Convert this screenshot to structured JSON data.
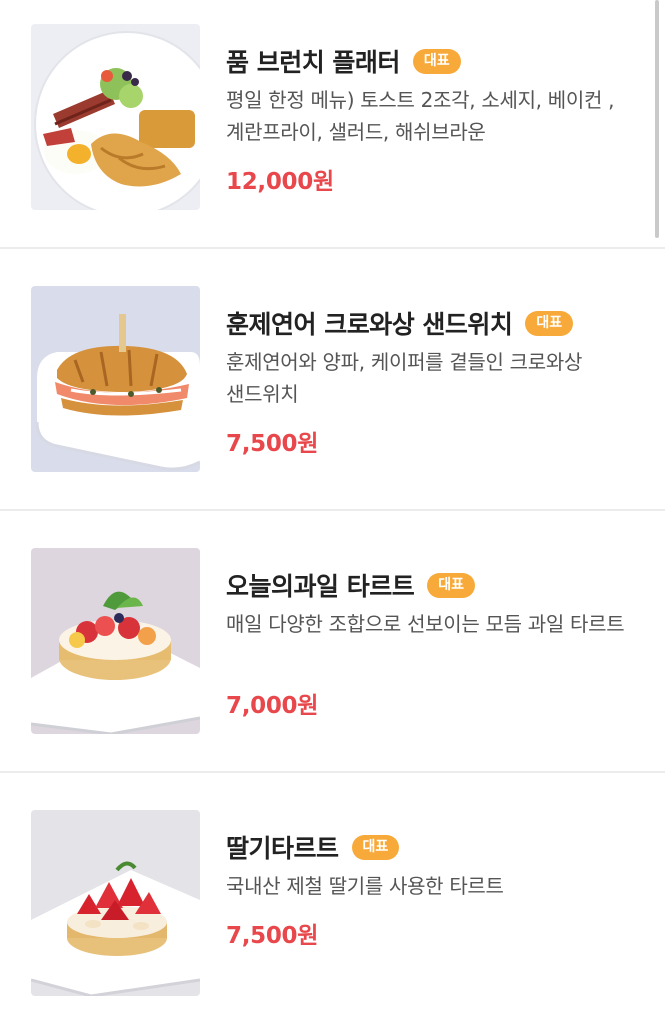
{
  "menu": {
    "badge_label": "대표",
    "items": [
      {
        "name": "품 브런치 플래터",
        "description": "평일 한정 메뉴) 토스트 2조각, 소세지, 베이컨 , 계란프라이, 샐러드, 해쉬브라운",
        "price": "12,000원",
        "image": "brunch-platter-photo"
      },
      {
        "name": "훈제연어 크로와상 샌드위치",
        "description": "훈제연어와 양파, 케이퍼를 곁들인 크로와상 샌드위치",
        "price": "7,500원",
        "image": "salmon-croissant-photo"
      },
      {
        "name": "오늘의과일 타르트",
        "description": "매일 다양한 조합으로 선보이는 모듬 과일 타르트",
        "price": "7,000원",
        "image": "fruit-tart-photo"
      },
      {
        "name": "딸기타르트",
        "description": "국내산 제철 딸기를 사용한 타르트",
        "price": "7,500원",
        "image": "strawberry-tart-photo"
      }
    ]
  },
  "colors": {
    "badge": "#f7a93a",
    "price": "#e8474b",
    "title": "#222222",
    "description": "#555555"
  }
}
